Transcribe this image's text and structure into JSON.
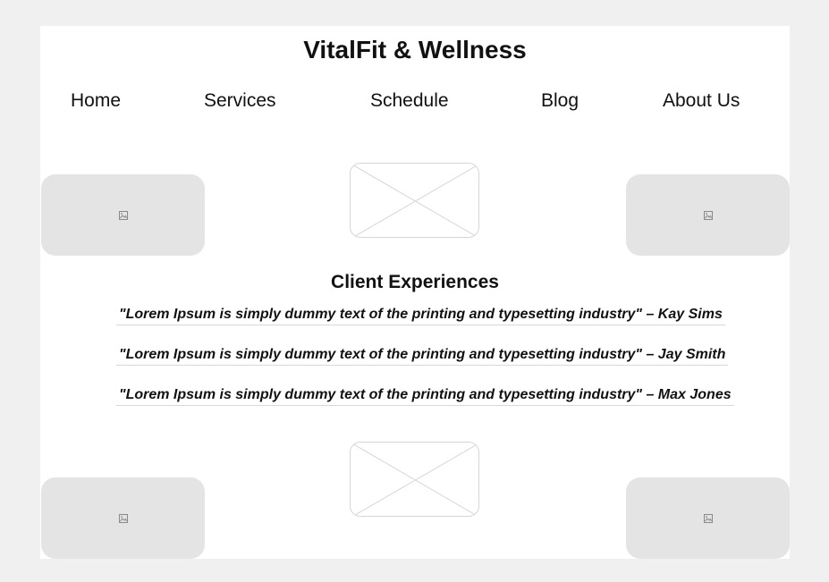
{
  "header": {
    "title": "VitalFit & Wellness"
  },
  "nav": {
    "items": [
      {
        "label": "Home"
      },
      {
        "label": "Services"
      },
      {
        "label": "Schedule"
      },
      {
        "label": "Blog"
      },
      {
        "label": "About Us"
      }
    ]
  },
  "icons": {
    "image_placeholder": "image-icon"
  },
  "colors": {
    "page_background": "#f0f0f0",
    "content_background": "#ffffff",
    "placeholder_gray": "#e4e4e4",
    "wireframe_stroke": "#d6d6d6",
    "text": "#111111"
  },
  "testimonials": {
    "title": "Client Experiences",
    "quotes": [
      {
        "text": "\"Lorem Ipsum is simply dummy text of the printing and typesetting industry\" – Kay Sims"
      },
      {
        "text": "\"Lorem Ipsum is simply dummy text of the printing and typesetting industry\" – Jay Smith"
      },
      {
        "text": "\"Lorem Ipsum is simply dummy text of the printing and typesetting industry\" – Max Jones"
      }
    ]
  }
}
